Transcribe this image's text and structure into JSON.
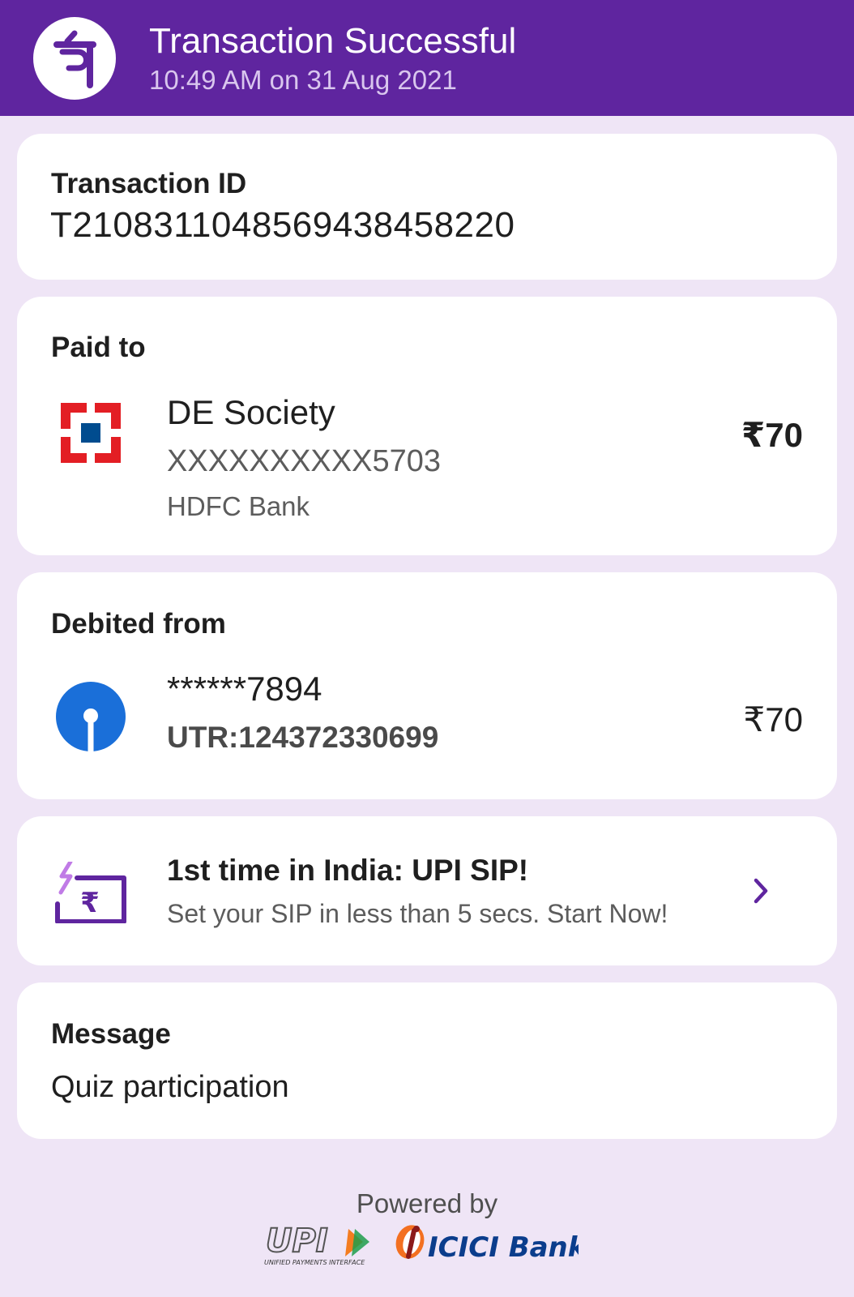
{
  "header": {
    "title": "Transaction Successful",
    "datetime": "10:49 AM on 31 Aug 2021",
    "logo_icon": "phonepe-logo-icon",
    "bg_color": "#5f259f"
  },
  "transaction": {
    "label": "Transaction ID",
    "id": "T2108311048569438458220"
  },
  "paid_to": {
    "label": "Paid to",
    "name": "DE Society",
    "account": "XXXXXXXXXX5703",
    "bank": "HDFC Bank",
    "amount": "₹70",
    "icon": "hdfc-bank-logo-icon"
  },
  "debited_from": {
    "label": "Debited from",
    "account": "******7894",
    "utr": "UTR:124372330699",
    "amount": "₹70",
    "icon": "sbi-logo-icon"
  },
  "promo": {
    "title": "1st time in India: UPI SIP!",
    "subtitle": "Set your SIP in less than 5 secs. Start Now!",
    "icon": "sip-rupee-icon",
    "action_icon": "chevron-right-icon"
  },
  "message": {
    "label": "Message",
    "text": "Quiz participation"
  },
  "footer": {
    "powered_by": "Powered by",
    "upi_logo_text": "UPI",
    "upi_tagline": "UNIFIED PAYMENTS INTERFACE",
    "bank_logo_text": "ICICI Bank"
  },
  "colors": {
    "accent": "#5f259f",
    "page_bg": "#efe5f6",
    "card_bg": "#ffffff",
    "hdfc_red": "#e31e24",
    "hdfc_blue": "#004c8f",
    "sbi_blue": "#1a6fd9"
  }
}
